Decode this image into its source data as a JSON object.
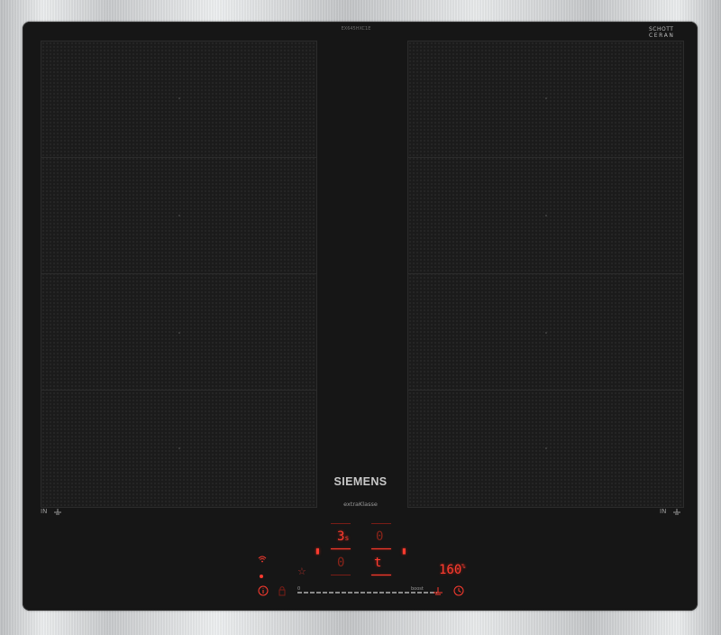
{
  "hob": {
    "model_code": "EX645HXC1E",
    "glass_brand_line1": "SCHOTT",
    "glass_brand_line2": "CERAN",
    "brand": "SIEMENS",
    "sub_brand": "extraKlasse",
    "zone_left_label": "IN",
    "zone_right_label": "IN"
  },
  "controls": {
    "top_display_value": "3",
    "top_display_suffix": "s",
    "top_right_display_value": "0",
    "bottom_left_display_value": "0",
    "bottom_right_display_value": "t",
    "timer_display_value": "160",
    "timer_unit": "%",
    "slider_start_label": "0",
    "slider_end_label": "boost"
  },
  "colors": {
    "glass": "#161616",
    "led_red": "#ff3b2f",
    "frame_steel": "#d9d9d9"
  },
  "icons": [
    "wifi-icon",
    "info-icon",
    "star-icon",
    "lock-icon",
    "pan-icon",
    "clock-icon",
    "bridge-icon"
  ]
}
